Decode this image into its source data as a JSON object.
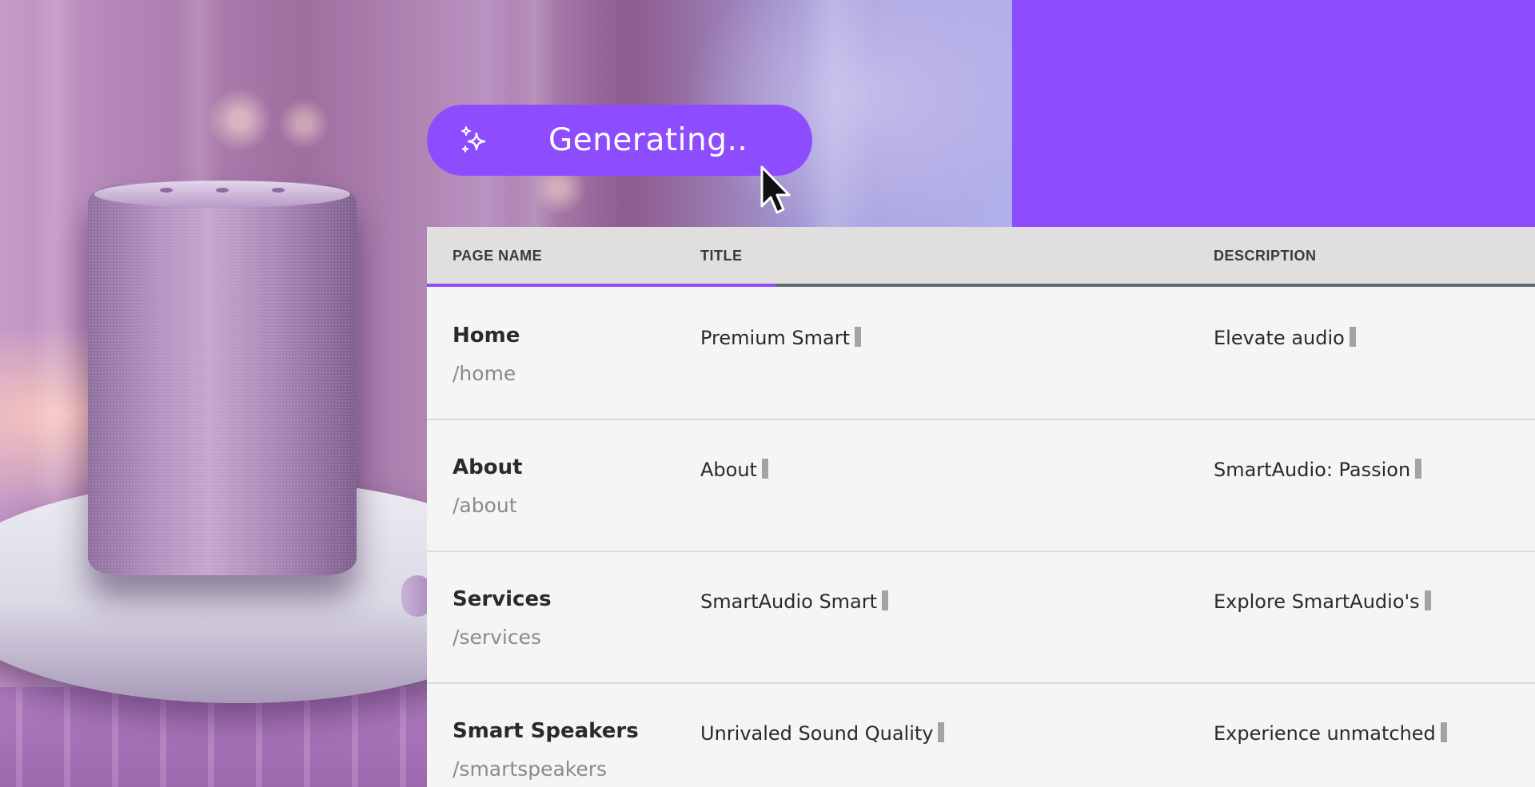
{
  "generating": {
    "label": "Generating.."
  },
  "progress": {
    "fraction": 0.315
  },
  "table": {
    "headers": {
      "page_name": "PAGE NAME",
      "title": "TITLE",
      "description": "DESCRIPTION"
    },
    "rows": [
      {
        "name": "Home",
        "path": "/home",
        "title": "Premium Smart",
        "description": "Elevate audio"
      },
      {
        "name": "About",
        "path": "/about",
        "title": "About",
        "description": "SmartAudio: Passion"
      },
      {
        "name": "Services",
        "path": "/services",
        "title": "SmartAudio Smart",
        "description": "Explore SmartAudio's"
      },
      {
        "name": "Smart Speakers",
        "path": "/smartspeakers",
        "title": "Unrivaled Sound Quality",
        "description": "Experience unmatched"
      }
    ]
  },
  "colors": {
    "accent": "#8d4dff",
    "header_bg": "#e0dfdd",
    "panel_bg": "#f5f5f5",
    "track": "#5f6c70"
  },
  "icons": {
    "generate": "sparkle-icon",
    "pointer": "mouse-cursor-icon"
  }
}
